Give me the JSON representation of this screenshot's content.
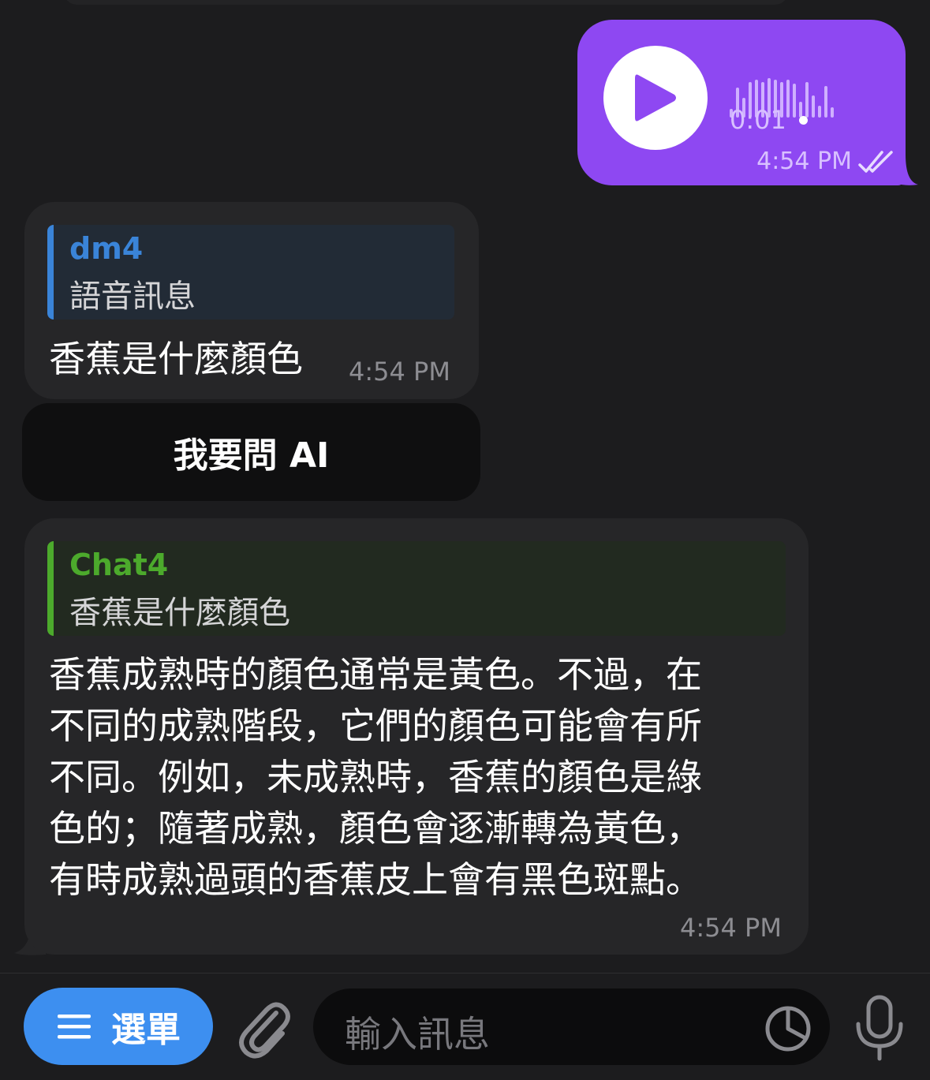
{
  "voice_message": {
    "duration": "0:01",
    "time": "4:54 PM",
    "waveform_levels": [
      0.22,
      0.75,
      0.5,
      0.9,
      0.95,
      0.9,
      1.0,
      0.95,
      0.9,
      0.95,
      0.85,
      0.4,
      0.9,
      0.55,
      0.3,
      0.8,
      0.25
    ],
    "icons": {
      "play": "play-icon",
      "status": "double-check-icon"
    }
  },
  "message_1": {
    "reply": {
      "name": "dm4",
      "text": "語音訊息"
    },
    "text": "香蕉是什麼顏色",
    "time": "4:54 PM"
  },
  "inline_button": {
    "label": "我要問 AI"
  },
  "message_2": {
    "reply": {
      "name": "Chat4",
      "text": "香蕉是什麼顏色"
    },
    "lines": [
      "香蕉成熟時的顏色通常是黃色。不過，在",
      "不同的成熟階段，它們的顏色可能會有所",
      "不同。例如，未成熟時，香蕉的顏色是綠",
      "色的；隨著成熟，顏色會逐漸轉為黃色，",
      "有時成熟過頭的香蕉皮上會有黑色斑點。"
    ],
    "time": "4:54 PM"
  },
  "composer": {
    "menu_label": "選單",
    "placeholder": "輸入訊息",
    "icons": [
      "menu-icon",
      "paperclip-icon",
      "sticker-icon",
      "microphone-icon"
    ]
  },
  "colors": {
    "background": "#1c1c1e",
    "outgoing_bubble": "#8e48f2",
    "incoming_bubble": "#262628",
    "dm4_accent": "#3a84d8",
    "chat4_accent": "#4caa2c",
    "menu_button": "#3d8ff0"
  }
}
